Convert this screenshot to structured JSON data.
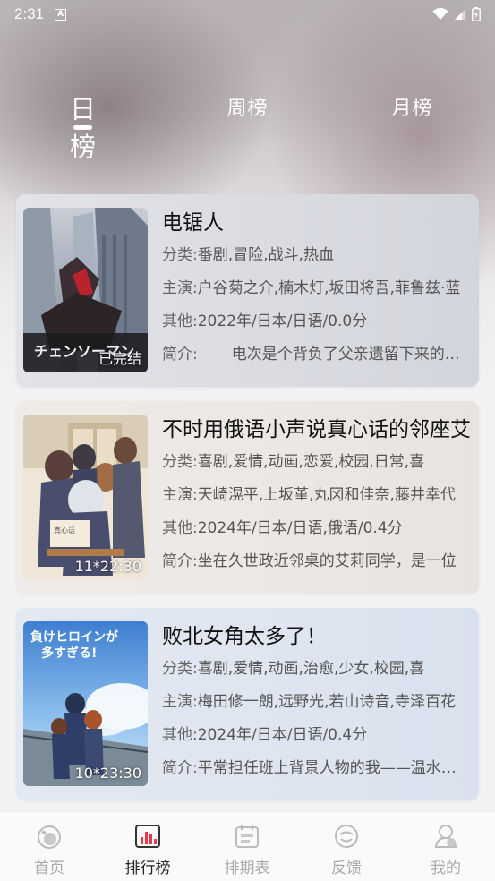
{
  "status_bar": {
    "time": "2:31",
    "notification_letter": "A"
  },
  "tabs": [
    {
      "label": "日榜",
      "active": true
    },
    {
      "label": "周榜",
      "active": false
    },
    {
      "label": "月榜",
      "active": false
    }
  ],
  "list": [
    {
      "title": "电锯人",
      "badge": "已完结",
      "category_label": "分类:",
      "category": "番剧,冒险,战斗,热血",
      "cast_label": "主演:",
      "cast": "户谷菊之介,楠木灯,坂田将吾,菲鲁兹·蓝",
      "other_label": "其他:",
      "other": "2022年/日本/日语/0.0分",
      "summary_label": "简介:",
      "summary": "电次是个背负了父亲遗留下来的巨额债务"
    },
    {
      "title": "不时用俄语小声说真心话的邻座艾莉同学",
      "badge": "11*22:30",
      "category_label": "分类:",
      "category": "喜剧,爱情,动画,恋爱,校园,日常,喜",
      "cast_label": "主演:",
      "cast": "天崎滉平,上坂堇,丸冈和佳奈,藤井幸代",
      "other_label": "其他:",
      "other": "2024年/日本/日语,俄语/0.4分",
      "summary_label": "简介:",
      "summary": "坐在久世政近邻桌的艾莉同学，是一位"
    },
    {
      "title": "败北女角太多了！",
      "badge": "10*23:30",
      "category_label": "分类:",
      "category": "喜剧,爱情,动画,治愈,少女,校园,喜",
      "cast_label": "主演:",
      "cast": "梅田修一朗,远野光,若山诗音,寺泽百花",
      "other_label": "其他:",
      "other": "2024年/日本/日语/0.4分",
      "summary_label": "简介:",
      "summary": "平常担任班上背景人物的我——温水和彦"
    }
  ],
  "bottom_nav": [
    {
      "label": "首页",
      "icon": "home-icon",
      "active": false
    },
    {
      "label": "排行榜",
      "icon": "chart-icon",
      "active": true
    },
    {
      "label": "排期表",
      "icon": "calendar-icon",
      "active": false
    },
    {
      "label": "反馈",
      "icon": "feedback-icon",
      "active": false
    },
    {
      "label": "我的",
      "icon": "profile-icon",
      "active": false
    }
  ],
  "colors": {
    "nav_active": "#222222",
    "nav_inactive": "#aaaaaa",
    "chart_icon_accent": "#e8394a"
  }
}
